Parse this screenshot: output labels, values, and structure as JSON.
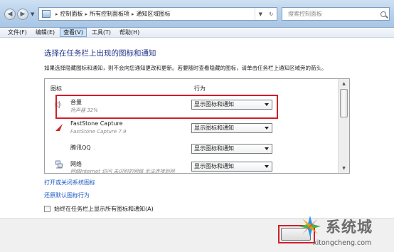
{
  "address_bar": {
    "breadcrumbs": [
      "控制面板",
      "所有控制面板项",
      "通知区域图标"
    ],
    "search_placeholder": "搜索控制面板"
  },
  "menu": {
    "items": [
      "文件(F)",
      "编辑(E)",
      "查看(V)",
      "工具(T)",
      "帮助(H)"
    ],
    "active_index": 2
  },
  "content": {
    "title": "选择在任务栏上出现的图标和通知",
    "description": "如果选择隐藏图标和通知，则不会向您通知更改和更新。若要随时查看隐藏的图标，请单击任务栏上通知区域旁的箭头。",
    "table": {
      "col_icon": "图标",
      "col_behavior": "行为",
      "rows": [
        {
          "name": "音量",
          "sub": "扬声器 32%",
          "behavior": "显示图标和通知",
          "icon": "speaker-icon"
        },
        {
          "name": "FastStone Capture",
          "sub": "FastStone Capture 7.9",
          "behavior": "显示图标和通知",
          "icon": "faststone-icon"
        },
        {
          "name": "腾讯QQ",
          "sub": "",
          "behavior": "显示图标和通知",
          "icon": "qq-icon"
        },
        {
          "name": "网络",
          "sub": "网络Internet 访问 未识别的网络 无法连接到网",
          "behavior": "显示图标和通知",
          "icon": "network-icon"
        }
      ]
    },
    "link_system_icons": "打开或关闭系统图标",
    "link_restore": "还原默认图标行为",
    "always_show_label": "始终在任务栏上显示所有图标和通知(A)",
    "always_show_checked": false
  },
  "watermark": {
    "title": "系统城",
    "url": "xitongcheng.com"
  },
  "colors": {
    "highlight": "#d21e2a",
    "title_text": "#1e3287",
    "link": "#1a57c2"
  }
}
